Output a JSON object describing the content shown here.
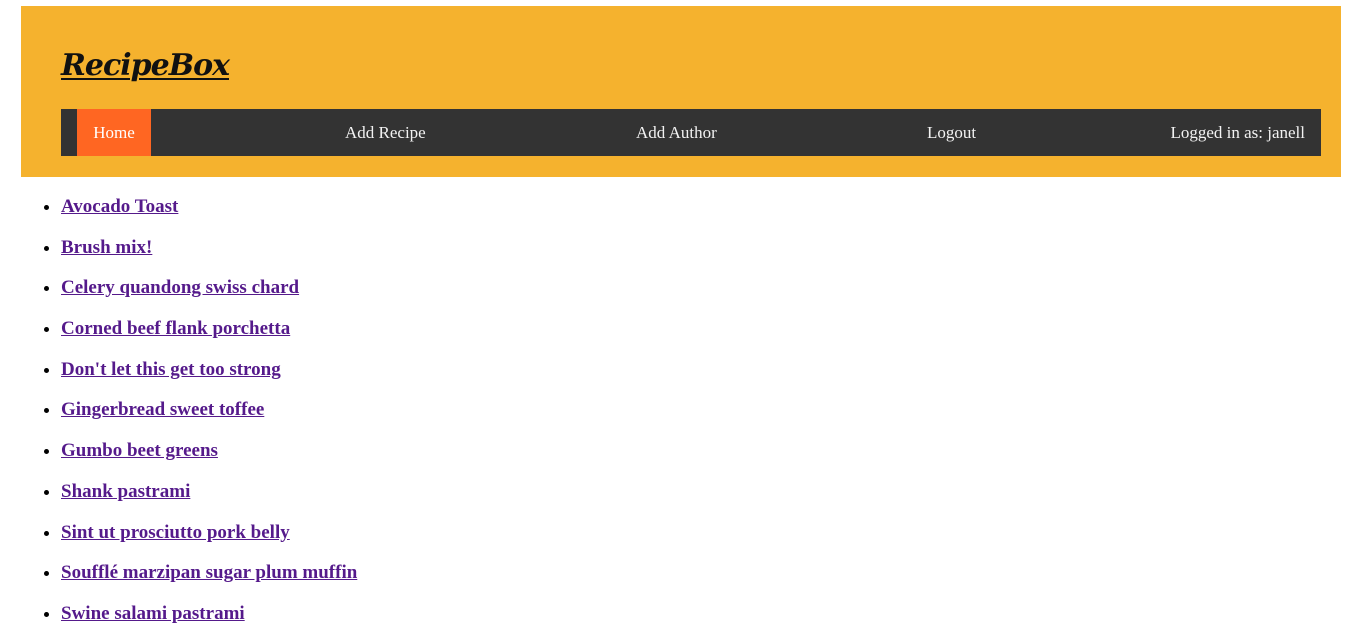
{
  "header": {
    "brand": "RecipeBox",
    "colors": {
      "background": "#f5b22e",
      "navbar": "#333333",
      "active_tab": "#ff6622",
      "link": "#551a8b"
    }
  },
  "nav": {
    "home": "Home",
    "add_recipe": "Add Recipe",
    "add_author": "Add Author",
    "logout": "Logout",
    "logged_in": "Logged in as: janell"
  },
  "recipes": [
    "Avocado Toast",
    "Brush mix!",
    "Celery quandong swiss chard",
    "Corned beef flank porchetta",
    "Don't let this get too strong",
    "Gingerbread sweet toffee",
    "Gumbo beet greens",
    "Shank pastrami",
    "Sint ut prosciutto pork belly",
    "Soufflé marzipan sugar plum muffin",
    "Swine salami pastrami"
  ]
}
